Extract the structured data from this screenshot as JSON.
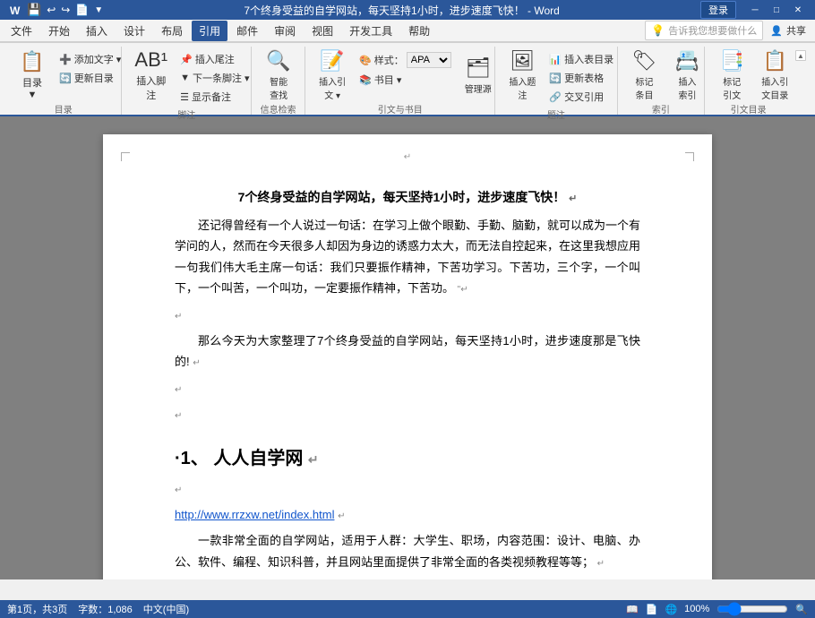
{
  "titleBar": {
    "documentTitle": "7个终身受益的自学网站，每天坚持1小时，进步速度飞快！",
    "appName": "Word",
    "loginLabel": "登录",
    "minBtn": "─",
    "maxBtn": "□",
    "closeBtn": "✕",
    "quickTools": [
      "💾",
      "↩",
      "↪",
      "📄",
      "▼"
    ]
  },
  "menuBar": {
    "items": [
      "文件",
      "开始",
      "插入",
      "设计",
      "布局",
      "引用",
      "邮件",
      "审阅",
      "视图",
      "开发工具",
      "帮助"
    ],
    "activeItem": "引用",
    "helpPlaceholder": "告诉我您想要做什么",
    "shareLabel": "共享"
  },
  "ribbon": {
    "groups": [
      {
        "label": "目录",
        "items": [
          {
            "type": "large",
            "icon": "📋",
            "label": "目录",
            "hasDropdown": true
          },
          {
            "type": "small-group",
            "items": [
              {
                "icon": "➕",
                "label": "添加文字",
                "hasDropdown": true
              },
              {
                "icon": "🔄",
                "label": "更新目录"
              }
            ]
          }
        ]
      },
      {
        "label": "脚注",
        "items": [
          {
            "type": "large",
            "icon": "📝",
            "label": "插入脚注"
          },
          {
            "type": "small-group",
            "items": [
              {
                "icon": "↩",
                "label": "插入尾注"
              },
              {
                "icon": "▼",
                "label": "下一条脚注",
                "hasDropdown": true
              },
              {
                "icon": "☰",
                "label": "显示备注"
              }
            ]
          }
        ]
      },
      {
        "label": "信息检索",
        "items": [
          {
            "type": "large",
            "icon": "🔍",
            "label": "智能\n查找"
          }
        ]
      },
      {
        "label": "引文与书目",
        "items": [
          {
            "type": "large",
            "icon": "📄",
            "label": "插入引文",
            "hasDropdown": true
          },
          {
            "type": "small-group",
            "items": [
              {
                "icon": "🎨",
                "label": "样式：",
                "isSelect": true,
                "selectValue": "APA"
              },
              {
                "icon": "📚",
                "label": "书目",
                "hasDropdown": true
              }
            ]
          },
          {
            "type": "large",
            "icon": "📌",
            "label": "管理源"
          }
        ]
      },
      {
        "label": "题注",
        "items": [
          {
            "type": "large",
            "icon": "🖼",
            "label": "插入题注"
          },
          {
            "type": "small-group",
            "items": [
              {
                "icon": "📊",
                "label": "插入表目录"
              },
              {
                "icon": "🔄",
                "label": "更新表格"
              },
              {
                "icon": "🔗",
                "label": "交叉引用"
              }
            ]
          }
        ]
      },
      {
        "label": "索引",
        "items": [
          {
            "type": "large",
            "icon": "🏷",
            "label": "标记\n条目"
          },
          {
            "type": "large",
            "icon": "📇",
            "label": "插入\n索引"
          }
        ]
      },
      {
        "label": "引文目录",
        "items": [
          {
            "type": "large",
            "icon": "📑",
            "label": "标记\n引文"
          },
          {
            "type": "large",
            "icon": "📋",
            "label": "插入引\n文目录"
          }
        ]
      }
    ]
  },
  "document": {
    "content": {
      "title": "7个终身受益的自学网站，每天坚持1小时，进步速度飞快！",
      "paragraphs": [
        "还记得曾经有一个人说过一句话：在学习上做个眼勤、手勤、脑勤，就可以成为一个有学问的人，然而在今天很多人却因为身边的诱惑力太大，而无法自控起来，在这里我想应用一句我们伟大毛主席一句话：我们只要振作精神，下苦功学习。下苦功，三个字，一个叫下，一个叫苦，一个叫功，一定要振作精神，下苦功。",
        "那么今天为大家整理了7个终身受益的自学网站，每天坚持1小时，进步速度那是飞快的!"
      ],
      "section1": {
        "label": "·1、",
        "title": "人人自学网",
        "url": "http://www.rrzxw.net/index.html",
        "description": "一款非常全面的自学网站，适用于人群：大学生、职场，内容范围：设计、电脑、办公、软件、编程、知识科普，并且网站里面提供了非常全面的各类视频教程等等；"
      }
    }
  },
  "statusBar": {
    "pageInfo": "第1页，共3页",
    "wordCount": "字数：1,086",
    "language": "中文(中国)",
    "zoomLevel": "100%",
    "viewButtons": [
      "📖",
      "📄",
      "📐",
      "🔍"
    ]
  }
}
